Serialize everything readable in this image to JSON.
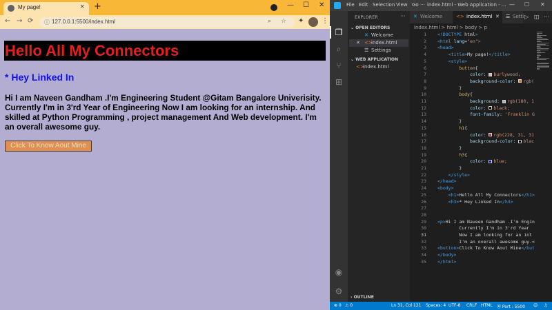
{
  "browser": {
    "tab": {
      "title": "My page!",
      "favicon": "globe-icon",
      "close": "×"
    },
    "new_tab": "+",
    "window_controls": {
      "minimize": "—",
      "maximize": "☐",
      "close": "✕"
    },
    "nav": {
      "back": "←",
      "forward": "→",
      "reload": "⟳"
    },
    "address": {
      "icon": "info-icon",
      "url": "127.0.0.1:5500/index.html"
    },
    "page": {
      "h1": "Hello All My Connectors",
      "h3": "* Hey Linked In",
      "paragraph": "Hi I am Naveen Gandham .I'm Engineering Student @Gitam Bangalore Univerisity. Currently I'm in 3'rd Year of Engineering Now I am looking for an internship. And skilled at Python Programming , project management And Web development. I'm an overall awesome guy.",
      "button": "Click To Know Aout Mine"
    }
  },
  "vscode": {
    "menu": [
      "File",
      "Edit",
      "Selection",
      "View",
      "Go",
      "···"
    ],
    "window_title": "index.html - Web Application - ...",
    "window_controls": {
      "minimize": "—",
      "maximize": "☐",
      "close": "✕"
    },
    "explorer": {
      "title": "EXPLORER",
      "more": "···",
      "open_editors_label": "OPEN EDITORS",
      "open_editors": [
        {
          "label": "Welcome",
          "icon": "vscode-icon"
        },
        {
          "label": "index.html",
          "icon": "html-icon",
          "close": "✕"
        },
        {
          "label": "Settings",
          "icon": "settings-icon"
        }
      ],
      "workspace_label": "WEB APPLICATION",
      "workspace_files": [
        {
          "label": "index.html",
          "icon": "html-icon"
        }
      ],
      "outline_label": "OUTLINE"
    },
    "tabs": [
      {
        "label": "Welcome",
        "icon": "vscode-icon"
      },
      {
        "label": "index.html",
        "icon": "html-icon",
        "close": "✕"
      },
      {
        "label": "Setti",
        "icon": "settings-icon"
      }
    ],
    "breadcrumb": "index.html > html > body > p",
    "current_line": 31,
    "code_lines": [
      {
        "n": 1,
        "t": "<!DOCTYPE html>"
      },
      {
        "n": 2,
        "t": "<html lang=\"en\">"
      },
      {
        "n": 3,
        "t": "<head>"
      },
      {
        "n": 4,
        "t": "    <title>My page!</title>"
      },
      {
        "n": 5,
        "t": "    <style>"
      },
      {
        "n": 6,
        "t": "        button{"
      },
      {
        "n": 7,
        "t": "            color: burlywood;"
      },
      {
        "n": 8,
        "t": "            background-color: rgb("
      },
      {
        "n": 9,
        "t": "        }"
      },
      {
        "n": 10,
        "t": "        body{"
      },
      {
        "n": 11,
        "t": "            background: rgb(180, 1"
      },
      {
        "n": 12,
        "t": "            color: black;"
      },
      {
        "n": 13,
        "t": "            font-family: 'Franklin G"
      },
      {
        "n": 14,
        "t": "        }"
      },
      {
        "n": 15,
        "t": "        h1{"
      },
      {
        "n": 16,
        "t": "            color: rgb(228, 31, 31"
      },
      {
        "n": 17,
        "t": "            background-color: blac"
      },
      {
        "n": 18,
        "t": "        }"
      },
      {
        "n": 19,
        "t": "        h3{"
      },
      {
        "n": 20,
        "t": "            color: blue;"
      },
      {
        "n": 21,
        "t": "        }"
      },
      {
        "n": 22,
        "t": "    </style>"
      },
      {
        "n": 23,
        "t": "</head>"
      },
      {
        "n": 24,
        "t": "<body>"
      },
      {
        "n": 25,
        "t": "    <h1>Hello All My Connectors</h1>"
      },
      {
        "n": 26,
        "t": "    <h3>* Hey Linked In</h3>"
      },
      {
        "n": 27,
        "t": ""
      },
      {
        "n": 28,
        "t": ""
      },
      {
        "n": 29,
        "t": "<p>Hi I am Naveen Gandham .I'm Engin"
      },
      {
        "n": 30,
        "t": "        Currently I'm in 3'rd Year"
      },
      {
        "n": 31,
        "t": "        Now I am looking for an int"
      },
      {
        "n": 32,
        "t": "        I'm an overall awesome guy.<"
      },
      {
        "n": 33,
        "t": "<button>Click To Know Aout Mine</but"
      },
      {
        "n": 34,
        "t": "</body>"
      },
      {
        "n": 35,
        "t": "</html>"
      }
    ],
    "status": {
      "errors": "⊗ 0",
      "warnings": "⚠ 0",
      "position": "Ln 31, Col 121",
      "spaces": "Spaces: 4",
      "encoding": "UTF-8",
      "eol": "CRLF",
      "language": "HTML",
      "port": "⦿ Port : 5500"
    }
  }
}
